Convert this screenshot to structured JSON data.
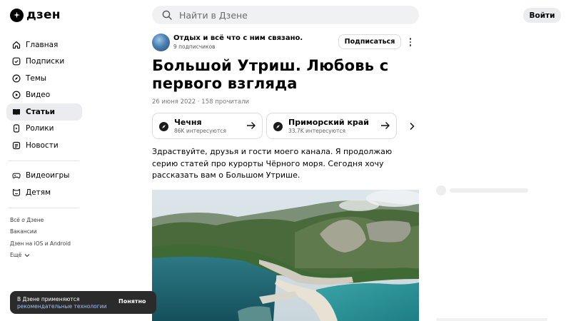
{
  "header": {
    "logo_text": "дзен",
    "search_placeholder": "Найти в Дзене",
    "login_label": "Войти"
  },
  "sidebar": {
    "items": [
      {
        "label": "Главная",
        "icon": "home-icon"
      },
      {
        "label": "Подписки",
        "icon": "subscriptions-icon"
      },
      {
        "label": "Темы",
        "icon": "compass-icon"
      },
      {
        "label": "Видео",
        "icon": "video-icon"
      },
      {
        "label": "Статьи",
        "icon": "articles-icon",
        "active": true
      },
      {
        "label": "Ролики",
        "icon": "shorts-icon"
      },
      {
        "label": "Новости",
        "icon": "news-icon"
      }
    ],
    "items2": [
      {
        "label": "Видеоигры",
        "icon": "gamepad-icon"
      },
      {
        "label": "Детям",
        "icon": "kids-icon"
      }
    ],
    "footer": [
      "Всё о Дзене",
      "Вакансии",
      "Дзен на iOS и Android",
      "Ещё"
    ]
  },
  "channel": {
    "name": "Отдых и всё что с ним связано.",
    "subscribers": "9 подписчиков",
    "subscribe_label": "Подписаться"
  },
  "article": {
    "title": "Большой Утриш. Любовь с первого взгляда",
    "meta": "26 июня 2022 · 158 прочитали",
    "text": "Здраствуйте, друзья и гости моего канала. Я продолжаю серию статей про курорты Чёрного моря. Сегодня хочу рассказать вам о Большом Утрише."
  },
  "tags": [
    {
      "name": "Чечня",
      "sub": "86K интересуются"
    },
    {
      "name": "Приморский край",
      "sub": "33.7K интересуются"
    }
  ],
  "toast": {
    "line1": "В Дзене применяются",
    "link": "рекомендательные технологии",
    "button": "Понятно"
  }
}
